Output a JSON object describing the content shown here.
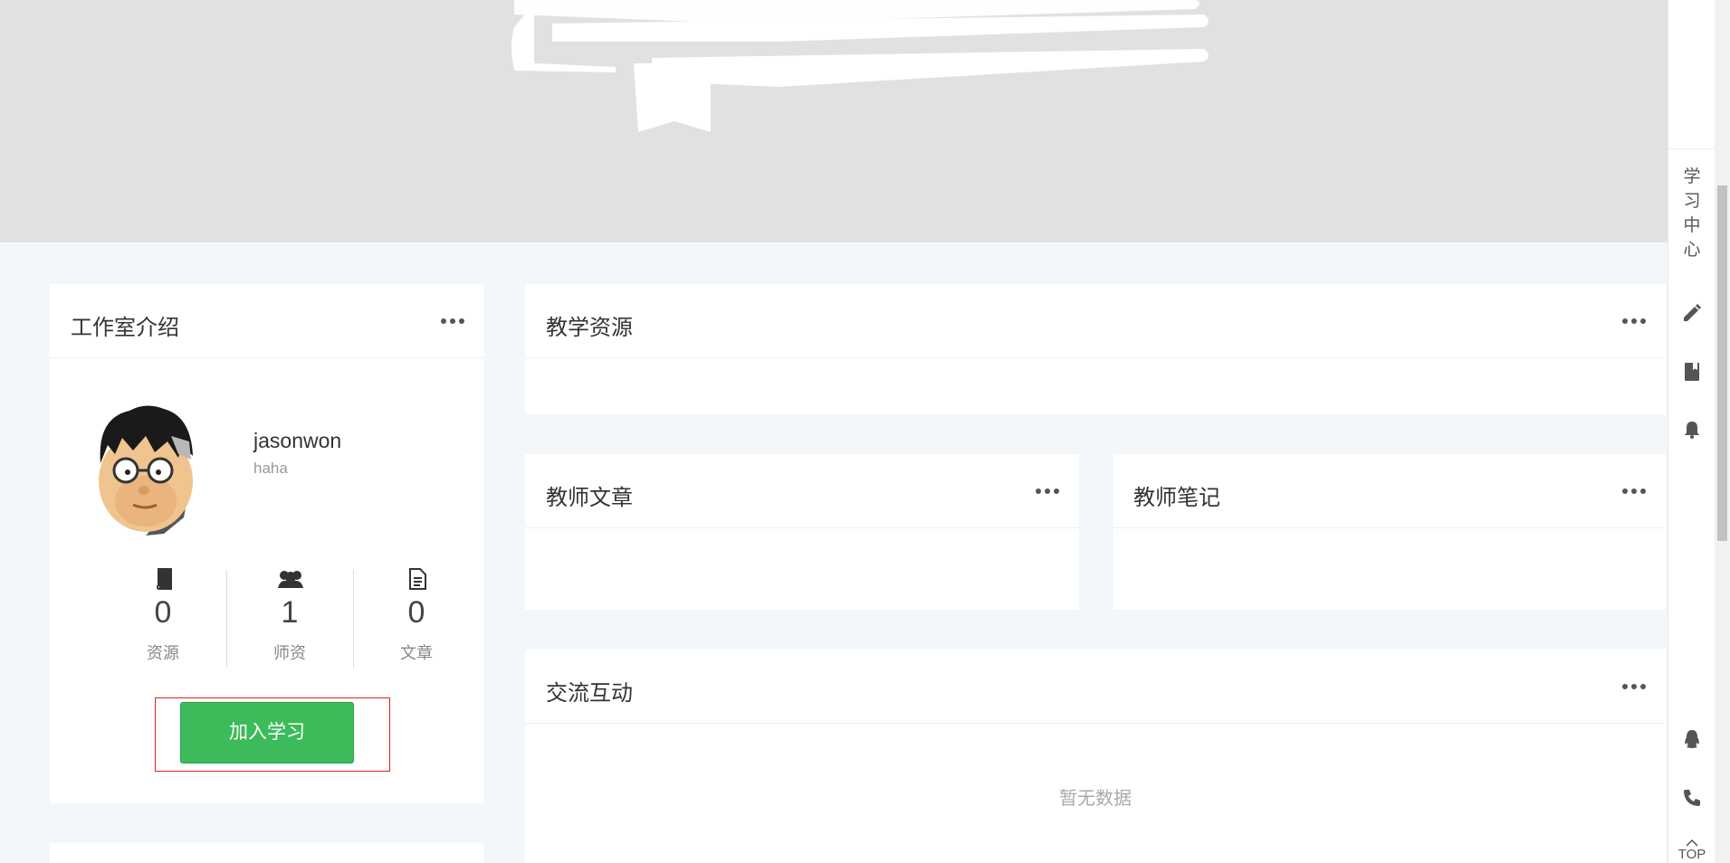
{
  "intro": {
    "title": "工作室介绍",
    "username": "jasonwon",
    "subtitle": "haha",
    "stats": [
      {
        "icon": "book-icon",
        "value": "0",
        "label": "资源"
      },
      {
        "icon": "users-icon",
        "value": "1",
        "label": "师资"
      },
      {
        "icon": "document-icon",
        "value": "0",
        "label": "文章"
      }
    ],
    "join_label": "加入学习"
  },
  "resources": {
    "title": "教学资源"
  },
  "articles": {
    "title": "教师文章"
  },
  "notes": {
    "title": "教师笔记"
  },
  "interaction": {
    "title": "交流互动",
    "empty_text": "暂无数据"
  },
  "toolbar": {
    "study_center": "学习中心",
    "icons": [
      "pencil-icon",
      "book-icon",
      "bell-icon",
      "qq-icon",
      "phone-icon"
    ],
    "top_label": "TOP"
  },
  "colors": {
    "join_button": "#3dbb5a",
    "highlight_outline": "#e02020",
    "page_background": "#f4f7f9",
    "banner": "#e1e1e1"
  }
}
